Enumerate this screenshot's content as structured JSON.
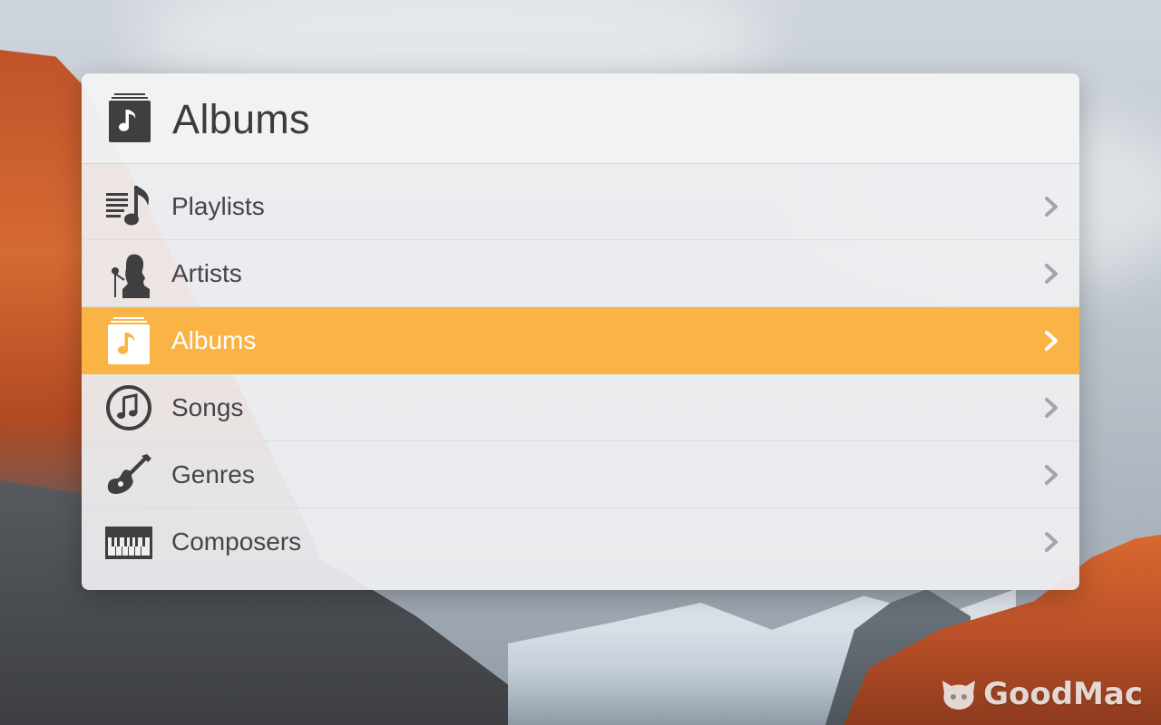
{
  "header": {
    "title": "Albums",
    "icon": "albums-icon"
  },
  "menu": {
    "items": [
      {
        "label": "Playlists",
        "icon": "playlists-icon",
        "selected": false
      },
      {
        "label": "Artists",
        "icon": "artists-icon",
        "selected": false
      },
      {
        "label": "Albums",
        "icon": "albums-icon",
        "selected": true
      },
      {
        "label": "Songs",
        "icon": "songs-icon",
        "selected": false
      },
      {
        "label": "Genres",
        "icon": "guitar-icon",
        "selected": false
      },
      {
        "label": "Composers",
        "icon": "piano-keyboard-icon",
        "selected": false
      }
    ]
  },
  "watermark": {
    "text": "GoodMac"
  },
  "colors": {
    "selection": "#fab446",
    "icon": "#3f3f42",
    "text": "#454548",
    "chevron": "#a3a5aa"
  }
}
